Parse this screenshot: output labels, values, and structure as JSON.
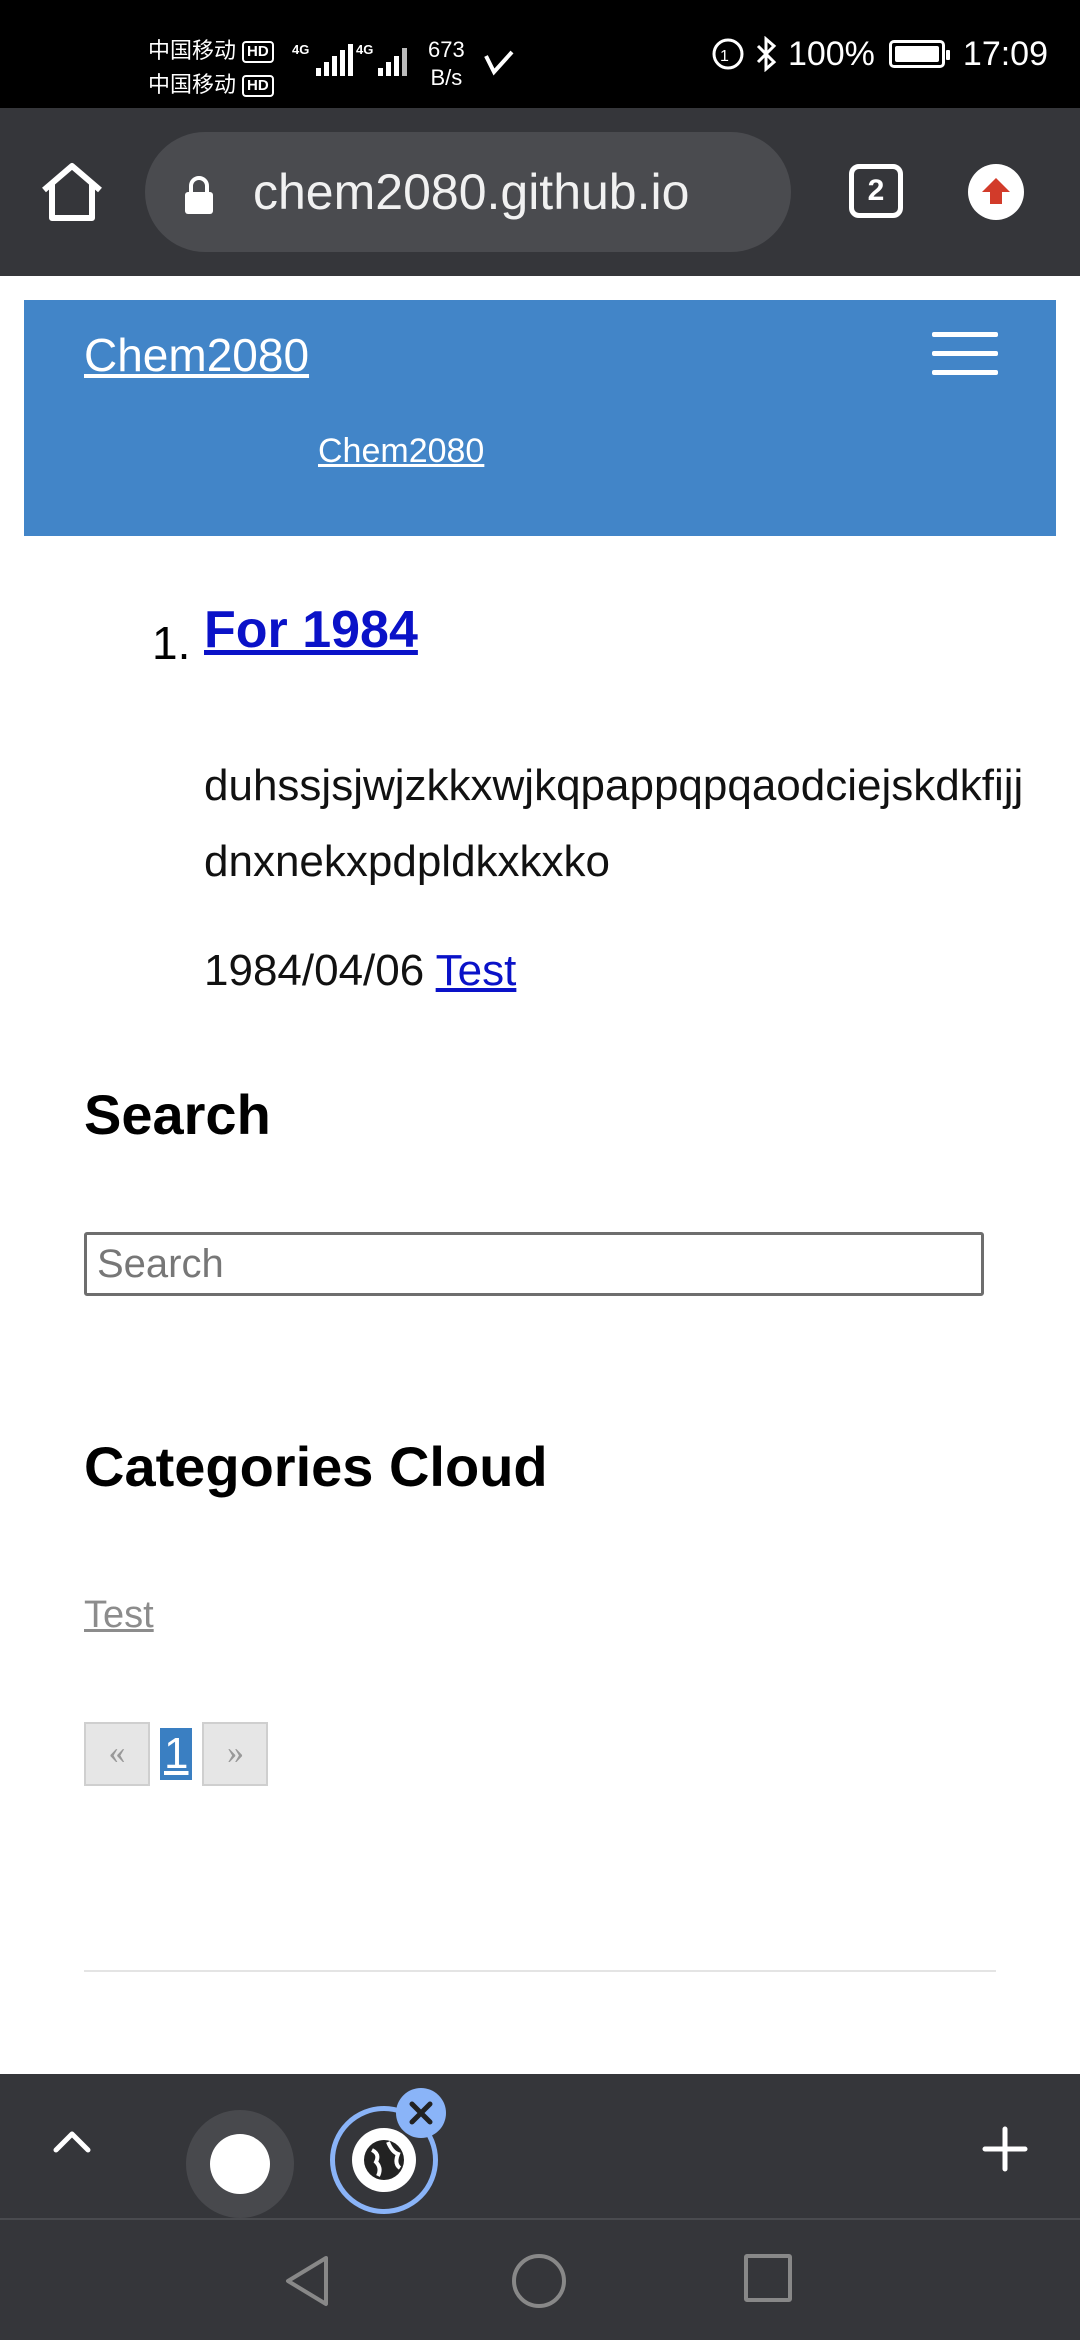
{
  "status_bar": {
    "carrier_1": "中国移动",
    "carrier_2": "中国移动",
    "hd_badge": "HD",
    "network_type": "4G",
    "net_speed_value": "673",
    "net_speed_unit": "B/s",
    "battery": "100%",
    "time": "17:09"
  },
  "browser": {
    "url": "chem2080.github.io",
    "tab_count": "2"
  },
  "header": {
    "site_title": "Chem2080",
    "breadcrumb": "Chem2080"
  },
  "posts": [
    {
      "number": "1.",
      "title": "For 1984",
      "excerpt": "duhssjsjwjzkkxwjkqpappqpqaodciejskdkfijjdnxnekxpdpldkxkxko",
      "date": "1984/04/06",
      "category": "Test"
    }
  ],
  "search": {
    "heading": "Search",
    "placeholder": "Search"
  },
  "categories": {
    "heading": "Categories Cloud",
    "items": [
      "Test"
    ]
  },
  "pagination": {
    "prev": "«",
    "current": "1",
    "next": "»"
  },
  "icons": {
    "home": "home-icon",
    "lock": "lock-icon",
    "update": "update-arrow-icon",
    "menu": "hamburger-menu-icon",
    "chevron": "chevron-up-icon",
    "plus": "plus-icon",
    "globe": "globe-icon",
    "close": "close-icon"
  },
  "colors": {
    "header_bg": "#4285c8",
    "link": "#0a12c8",
    "toolbar_bg": "#35363a",
    "active_tab_ring": "#8ab4f8"
  }
}
